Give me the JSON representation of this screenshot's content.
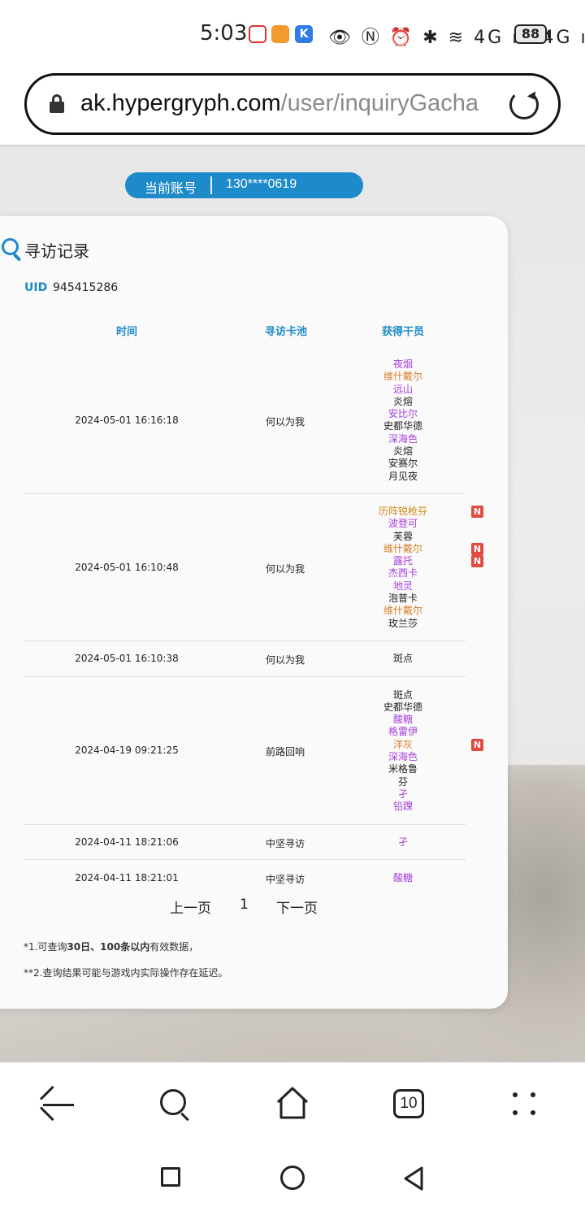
{
  "status_bar": {
    "time": "5:03",
    "app_icons": [
      "app-icon-1",
      "app-icon-2",
      "app-icon-3"
    ],
    "indicators": "👁 Ⓝ ⏰ ✱ ≋ 4G ıll 4G ıll",
    "battery": "88"
  },
  "browser": {
    "url_host": "ak.hypergryph.com",
    "url_path": "/user/inquiryGacha"
  },
  "account": {
    "label": "当前账号",
    "value": "130****0619"
  },
  "card": {
    "title": "寻访记录",
    "uid_label": "UID",
    "uid_value": "945415286"
  },
  "table": {
    "headers": {
      "time": "时间",
      "pool": "寻访卡池",
      "operators": "获得干员"
    },
    "rows": [
      {
        "time": "2024-05-01 16:16:18",
        "pool": "何以为我",
        "operators": [
          {
            "name": "夜烟",
            "rarity": 4
          },
          {
            "name": "维什戴尔",
            "rarity": 5
          },
          {
            "name": "远山",
            "rarity": 4
          },
          {
            "name": "炎熔",
            "rarity": 3
          },
          {
            "name": "安比尔",
            "rarity": 4
          },
          {
            "name": "史都华德",
            "rarity": 3
          },
          {
            "name": "深海色",
            "rarity": 4
          },
          {
            "name": "炎熔",
            "rarity": 3
          },
          {
            "name": "安赛尔",
            "rarity": 3
          },
          {
            "name": "月见夜",
            "rarity": 3
          }
        ]
      },
      {
        "time": "2024-05-01 16:10:48",
        "pool": "何以为我",
        "operators": [
          {
            "name": "历阵锐枪芬",
            "rarity": 6,
            "new": "N"
          },
          {
            "name": "波登可",
            "rarity": 4
          },
          {
            "name": "芙蓉",
            "rarity": 3
          },
          {
            "name": "维什戴尔",
            "rarity": 5,
            "new": "N"
          },
          {
            "name": "露托",
            "rarity": 4,
            "new": "N"
          },
          {
            "name": "杰西卡",
            "rarity": 4
          },
          {
            "name": "地灵",
            "rarity": 4
          },
          {
            "name": "泡普卡",
            "rarity": 3
          },
          {
            "name": "维什戴尔",
            "rarity": 5
          },
          {
            "name": "玫兰莎",
            "rarity": 3
          }
        ]
      },
      {
        "time": "2024-05-01 16:10:38",
        "pool": "何以为我",
        "operators": [
          {
            "name": "斑点",
            "rarity": 3
          }
        ]
      },
      {
        "time": "2024-04-19 09:21:25",
        "pool": "前路回响",
        "operators": [
          {
            "name": "斑点",
            "rarity": 3
          },
          {
            "name": "史都华德",
            "rarity": 3
          },
          {
            "name": "酸糖",
            "rarity": 4
          },
          {
            "name": "格雷伊",
            "rarity": 4
          },
          {
            "name": "洋灰",
            "rarity": 5,
            "new": "N"
          },
          {
            "name": "深海色",
            "rarity": 4
          },
          {
            "name": "米格鲁",
            "rarity": 3
          },
          {
            "name": "芬",
            "rarity": 3
          },
          {
            "name": "孑",
            "rarity": 4
          },
          {
            "name": "铅踝",
            "rarity": 4
          }
        ]
      },
      {
        "time": "2024-04-11 18:21:06",
        "pool": "中坚寻访",
        "operators": [
          {
            "name": "孑",
            "rarity": 4
          }
        ]
      },
      {
        "time": "2024-04-11 18:21:01",
        "pool": "中坚寻访",
        "operators": [
          {
            "name": "酸糖",
            "rarity": 4
          }
        ]
      }
    ]
  },
  "pagination": {
    "prev": "上一页",
    "page": "1",
    "next": "下一页"
  },
  "notes": {
    "note1_prefix": "*1.可查询",
    "note1_bold1": "30日",
    "note1_sep": "、",
    "note1_bold2": "100条以内",
    "note1_suffix": "有效数据，",
    "note2": "**2.查询结果可能与游戏内实际操作存在延迟。"
  },
  "bottom_nav": {
    "tab_count": "10"
  },
  "colors": {
    "accent": "#1d8ac9",
    "rarity3": "#222222",
    "rarity4": "#a43fdb",
    "rarity5": "#d9802a",
    "rarity6": "#cf8a14",
    "new_badge": "#e04a3f"
  }
}
